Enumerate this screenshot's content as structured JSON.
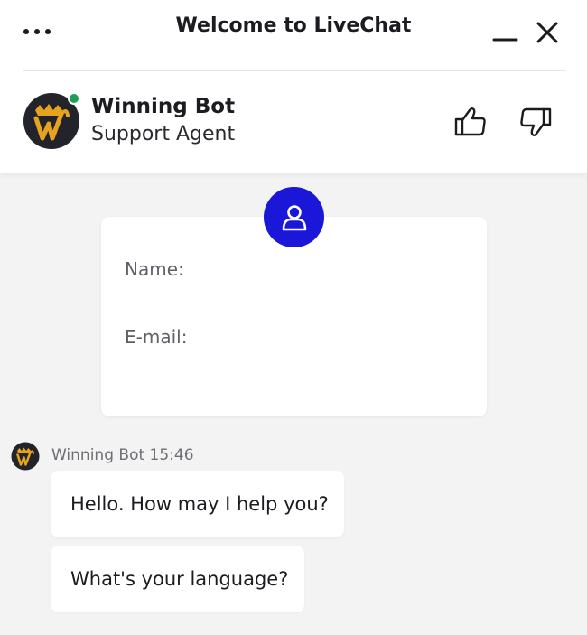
{
  "window": {
    "title": "Welcome to LiveChat",
    "menu_icon": "more-dots-icon",
    "minimize_icon": "minimize-icon",
    "close_icon": "close-icon"
  },
  "agent": {
    "name": "Winning Bot",
    "role": "Support Agent",
    "status": "online",
    "avatar_icon": "winning-bot-logo",
    "rate_good_icon": "thumbs-up-icon",
    "rate_bad_icon": "thumbs-down-icon"
  },
  "prechat_form": {
    "icon": "user-icon",
    "fields": [
      {
        "label": "Name:",
        "value": ""
      },
      {
        "label": "E-mail:",
        "value": ""
      }
    ]
  },
  "messages": {
    "author": "Winning Bot",
    "time": "15:46",
    "meta": "Winning Bot 15:46",
    "items": [
      {
        "text": "Hello. How may I help you?"
      },
      {
        "text": "What's your language?"
      }
    ]
  },
  "colors": {
    "accent": "#1a17d8",
    "online": "#1f9d55",
    "logo_gold": "#e6a31e",
    "logo_dark": "#23232b",
    "background": "#f3f3f3"
  }
}
